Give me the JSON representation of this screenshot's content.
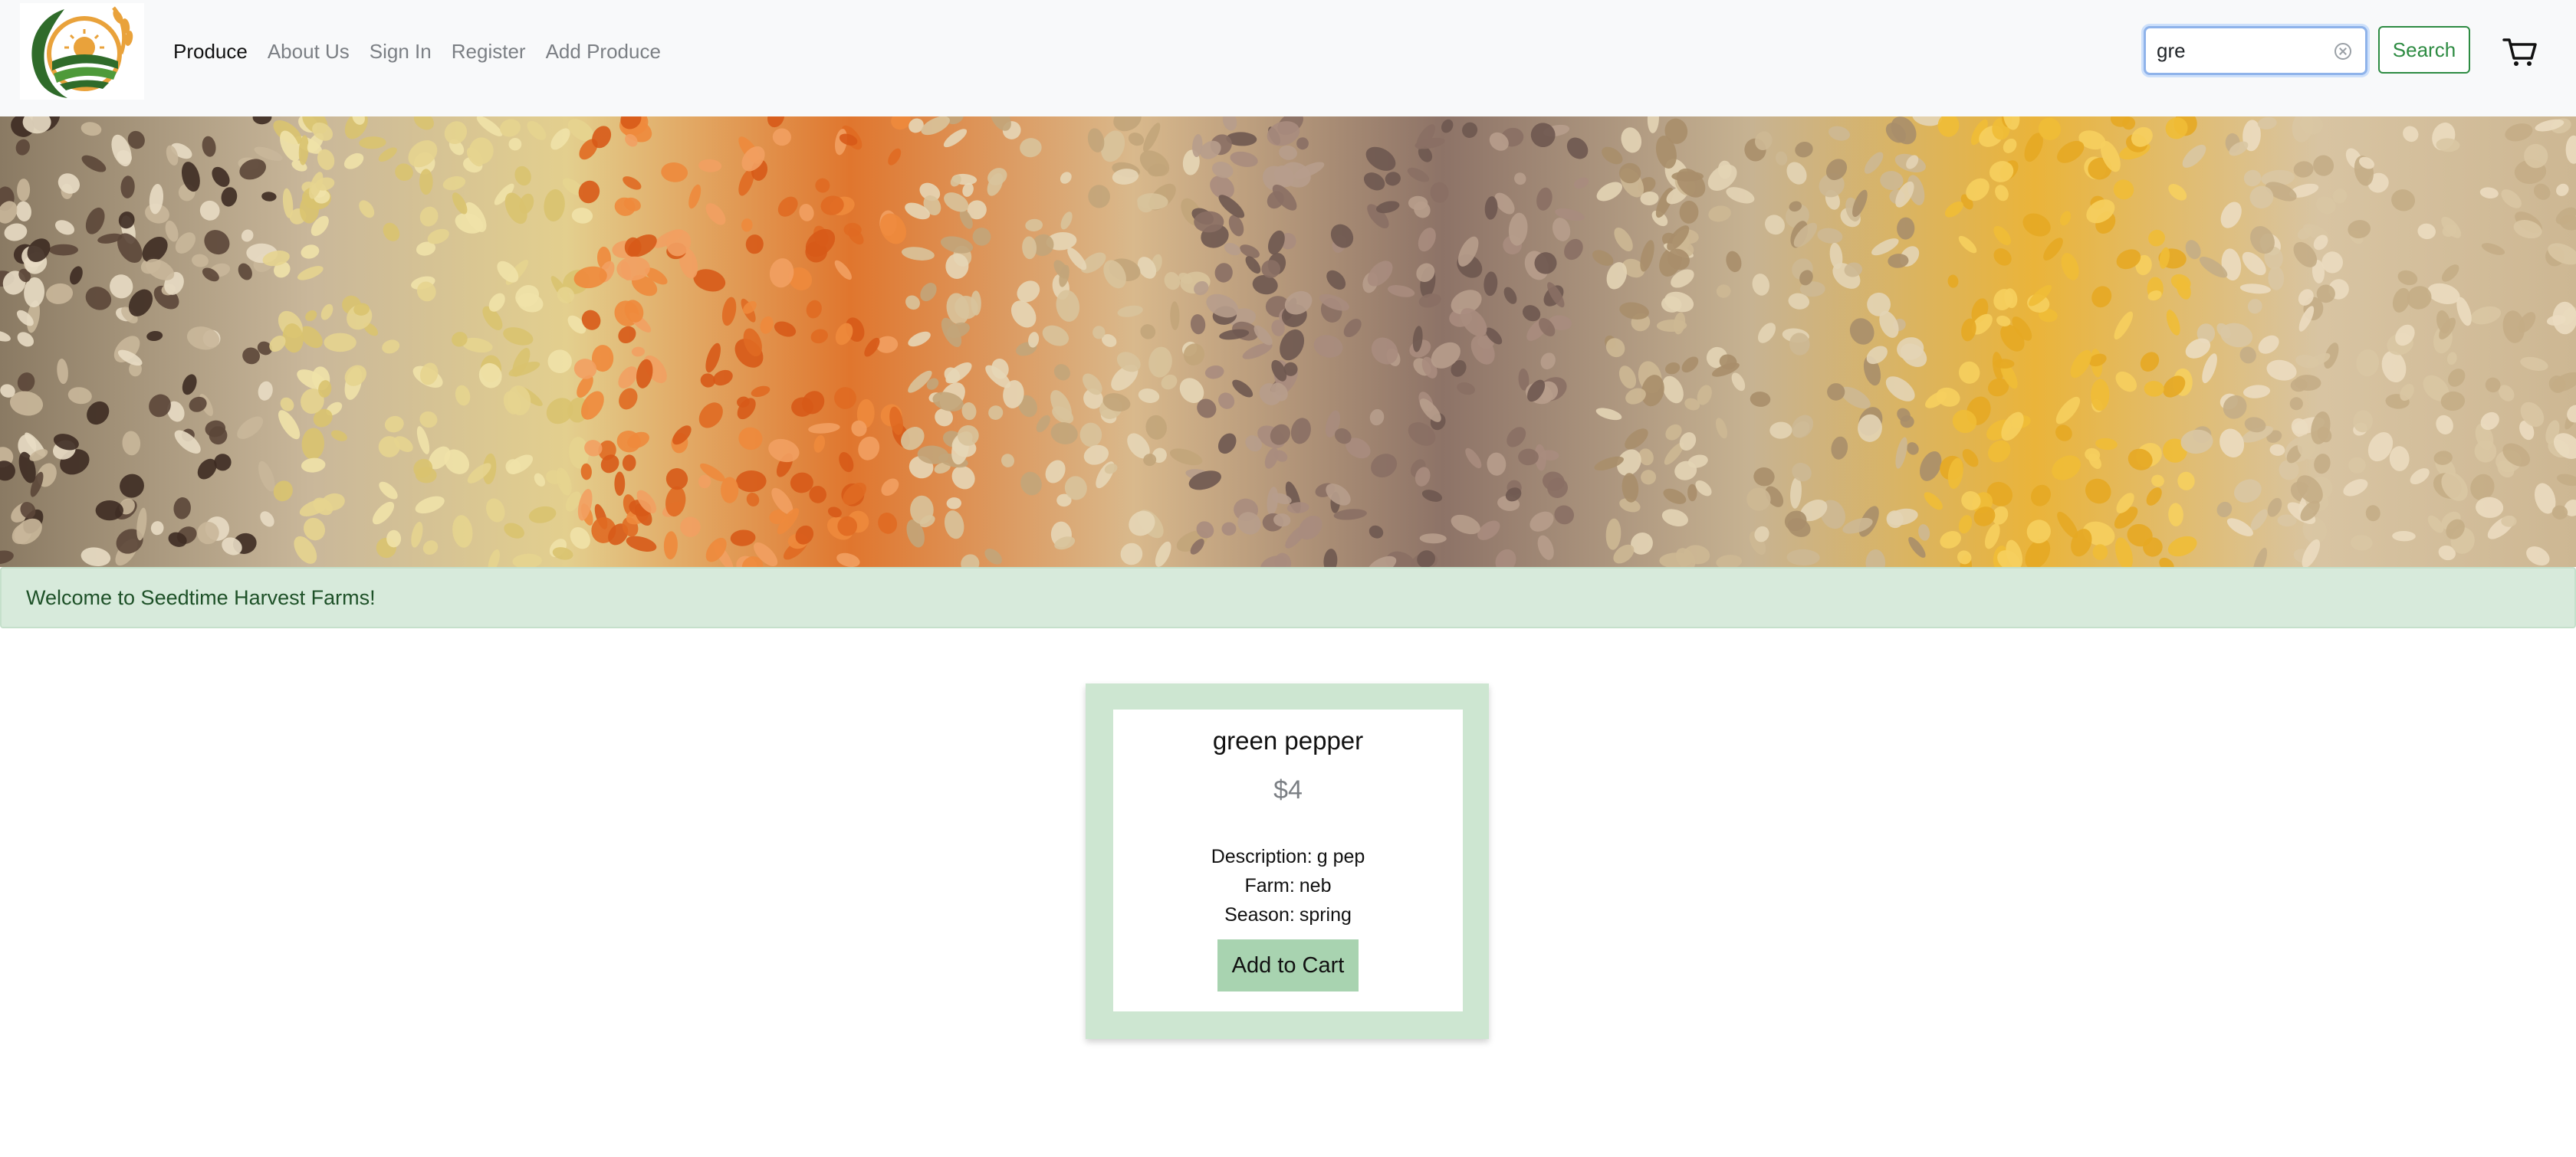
{
  "nav": {
    "links": [
      "Produce",
      "About Us",
      "Sign In",
      "Register",
      "Add Produce"
    ]
  },
  "search": {
    "value": "gre",
    "button_label": "Search"
  },
  "alert": {
    "message": "Welcome to Seedtime Harvest Farms!"
  },
  "product": {
    "name": "green pepper",
    "price": "$4",
    "description_label": "Description:",
    "description": "g pep",
    "farm_label": "Farm:",
    "farm": "neb",
    "season_label": "Season:",
    "season": "spring",
    "add_button": "Add to Cart"
  },
  "icons": {
    "logo": "farm-logo-icon",
    "cart": "cart-icon",
    "clear": "clear-icon"
  },
  "colors": {
    "accent_green": "#2d8b42",
    "alert_bg": "#d7eadb",
    "card_frame": "#cde6d1",
    "button_bg": "#a8d3b0"
  }
}
